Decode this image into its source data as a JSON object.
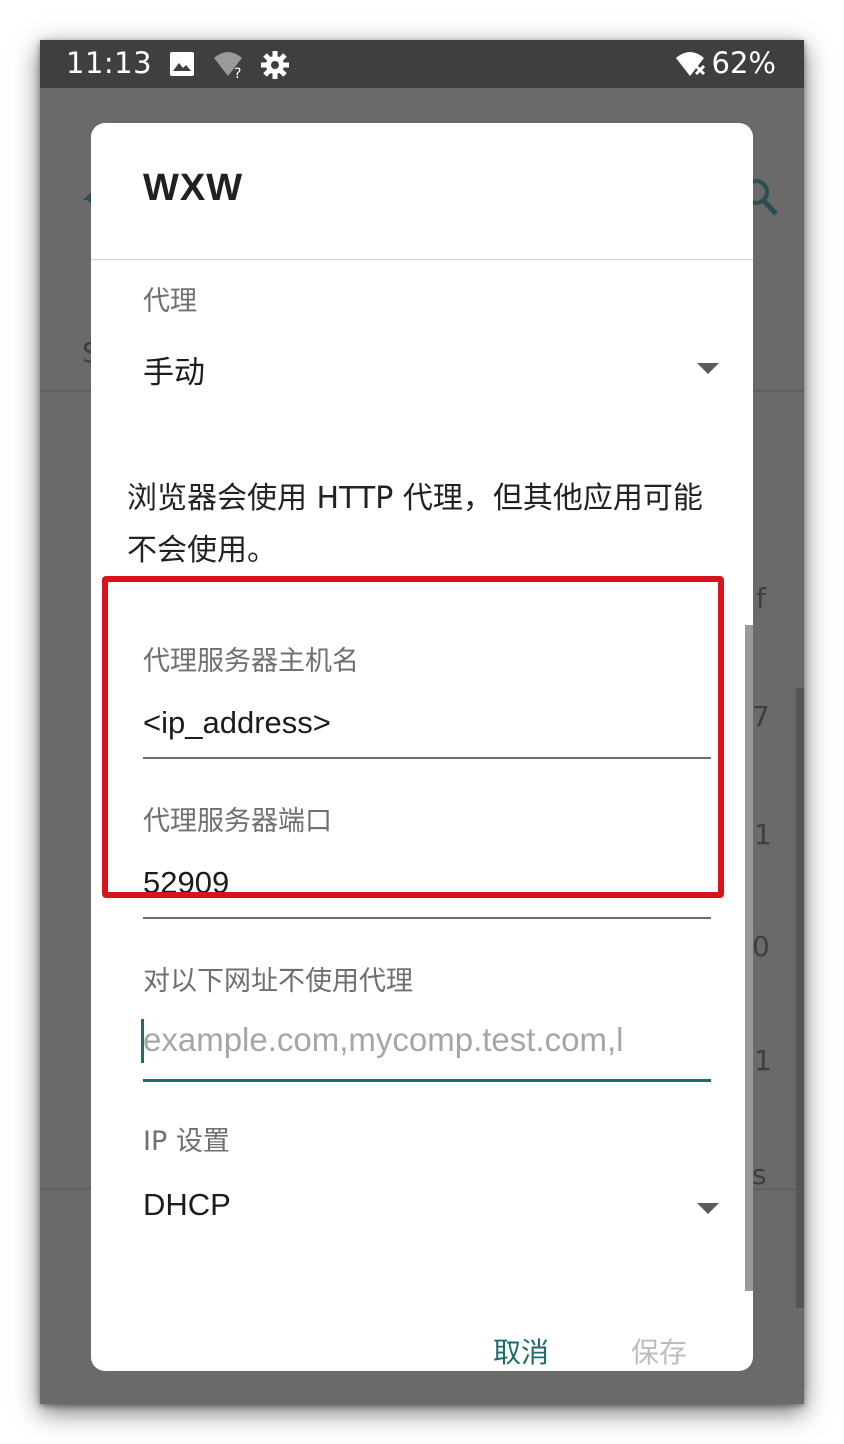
{
  "status_bar": {
    "time": "11:13",
    "battery": "62%",
    "icons": [
      "image-icon",
      "wifi-question-icon",
      "settings-gear-icon",
      "wifi-off-icon"
    ]
  },
  "dialog": {
    "title": "WXW",
    "proxy": {
      "label": "代理",
      "value": "手动"
    },
    "note": "浏览器会使用 HTTP 代理，但其他应用可能不会使用。",
    "proxy_hostname": {
      "label": "代理服务器主机名",
      "value": "<ip_address>"
    },
    "proxy_port": {
      "label": "代理服务器端口",
      "value": "52909"
    },
    "bypass": {
      "label": "对以下网址不使用代理",
      "placeholder": "example.com,mycomp.test.com,l"
    },
    "ip_settings": {
      "label": "IP 设置",
      "value": "DHCP"
    },
    "buttons": {
      "cancel": "取消",
      "save": "保存"
    }
  },
  "background": {
    "side_chars": [
      "f",
      "7",
      "1",
      "0",
      "1",
      "s"
    ],
    "left_char": "S"
  },
  "colors": {
    "accent": "#1e6b6e",
    "highlight": "#d9121b",
    "disabled": "#bdbdbd"
  }
}
